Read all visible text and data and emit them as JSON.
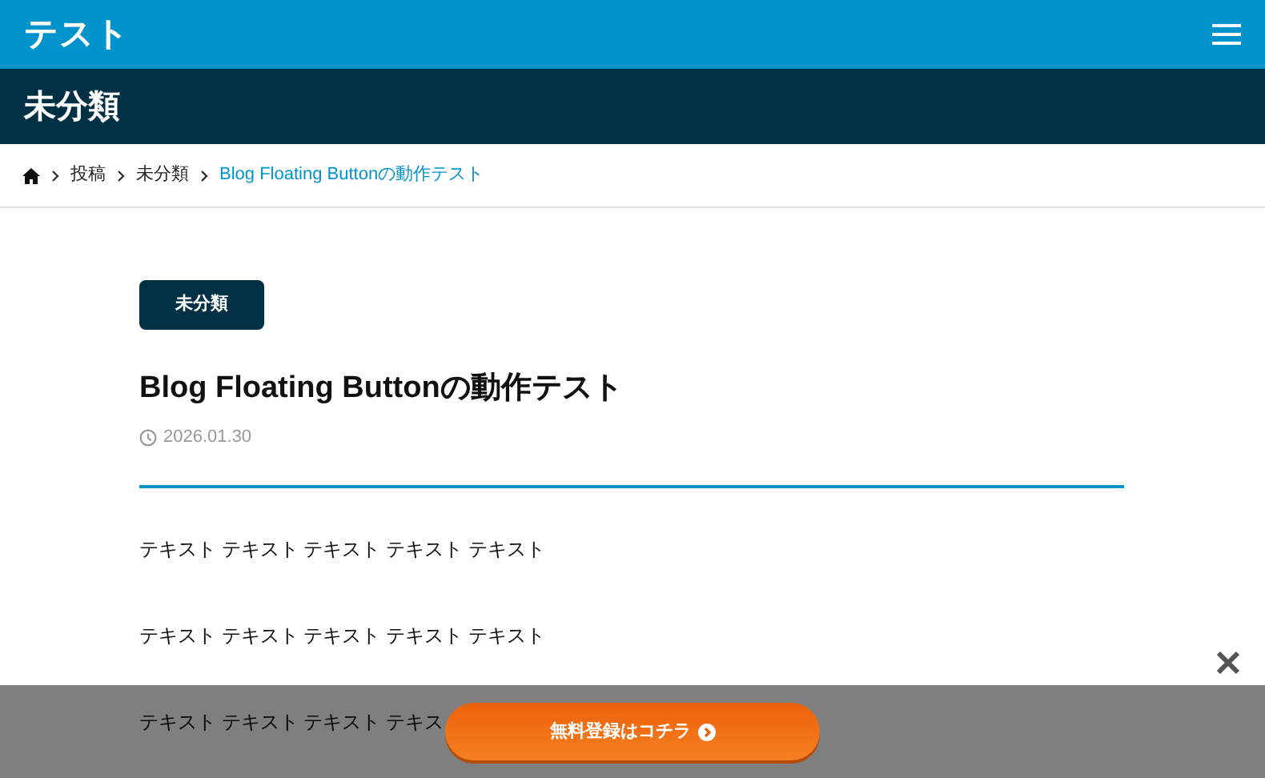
{
  "site_title": "テスト",
  "category_title": "未分類",
  "breadcrumb": [
    {
      "label": "投稿",
      "current": false
    },
    {
      "label": "未分類",
      "current": false
    },
    {
      "label": "Blog Floating Buttonの動作テスト",
      "current": true
    }
  ],
  "article": {
    "tag": "未分類",
    "title": "Blog Floating Buttonの動作テスト",
    "date": "2026.01.30",
    "paragraphs": [
      "テキスト テキスト テキスト テキスト テキスト",
      "テキスト テキスト テキスト テキスト テキスト",
      "テキスト テキスト テキスト テキス"
    ]
  },
  "floating_bar": {
    "button": "無料登録はコチラ"
  }
}
